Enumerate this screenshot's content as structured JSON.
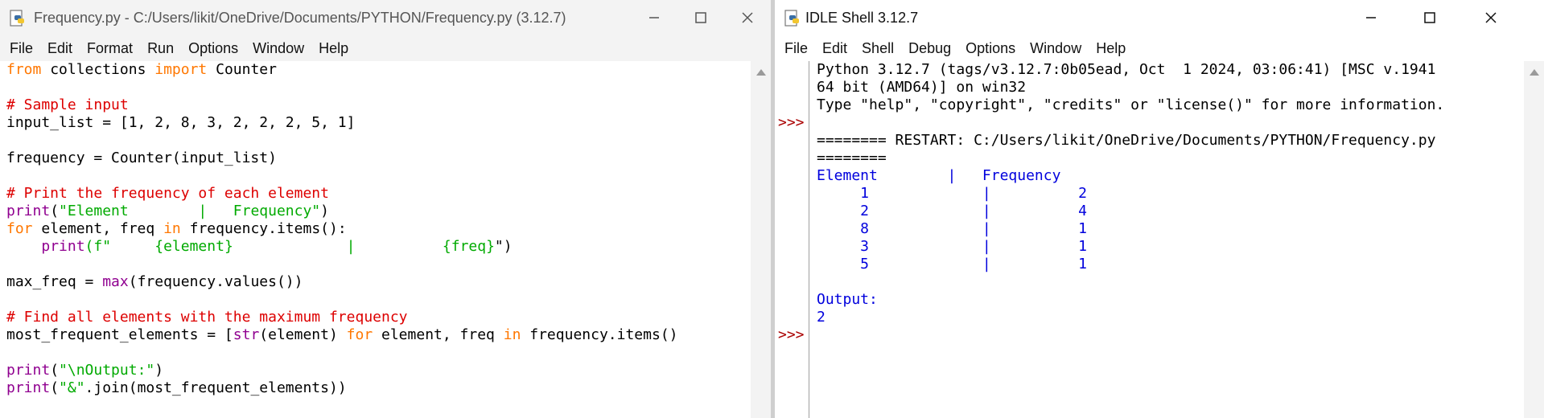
{
  "editor_window": {
    "title": "Frequency.py - C:/Users/likit/OneDrive/Documents/PYTHON/Frequency.py (3.12.7)",
    "menu": [
      "File",
      "Edit",
      "Format",
      "Run",
      "Options",
      "Window",
      "Help"
    ],
    "code": {
      "l1": {
        "a": "from",
        "b": " collections ",
        "c": "import",
        "d": " Counter"
      },
      "l3": "# Sample input",
      "l4": "input_list = [1, 2, 8, 3, 2, 2, 2, 5, 1]",
      "l6": "frequency = Counter(input_list)",
      "l8": "# Print the frequency of each element",
      "l9": {
        "a": "print",
        "b": "(",
        "c": "\"Element        |   Frequency\"",
        "d": ")"
      },
      "l10": {
        "a": "for",
        "b": " element, freq ",
        "c": "in",
        "d": " frequency.items():"
      },
      "l11": {
        "a": "    ",
        "b": "print",
        "c": "(f\"     ",
        "d": "{element}",
        "e": "             |          ",
        "f": "{freq}",
        "g": "\")"
      },
      "l13": {
        "a": "max_freq = ",
        "b": "max",
        "c": "(frequency.values())"
      },
      "l15": "# Find all elements with the maximum frequency",
      "l16": {
        "a": "most_frequent_elements = [",
        "b": "str",
        "c": "(element) ",
        "d": "for",
        "e": " element, freq ",
        "f": "in",
        "g": " frequency.items()"
      },
      "l18": {
        "a": "print",
        "b": "(",
        "c": "\"\\nOutput:\"",
        "d": ")"
      },
      "l19": {
        "a": "print",
        "b": "(",
        "c": "\"&\"",
        "d": ".join(most_frequent_elements))"
      }
    }
  },
  "shell_window": {
    "title": "IDLE Shell 3.12.7",
    "menu": [
      "File",
      "Edit",
      "Shell",
      "Debug",
      "Options",
      "Window",
      "Help"
    ],
    "prompt": ">>>",
    "lines": {
      "l1": "Python 3.12.7 (tags/v3.12.7:0b05ead, Oct  1 2024, 03:06:41) [MSC v.1941",
      "l2": "64 bit (AMD64)] on win32",
      "l3": "Type \"help\", \"copyright\", \"credits\" or \"license()\" for more information.",
      "l4": "======== RESTART: C:/Users/likit/OneDrive/Documents/PYTHON/Frequency.py",
      "l5": "========",
      "o1": "Element        |   Frequency",
      "o2": "     1             |          2",
      "o3": "     2             |          4",
      "o4": "     8             |          1",
      "o5": "     3             |          1",
      "o6": "     5             |          1",
      "o8": "Output:",
      "o9": "2"
    }
  },
  "colors": {
    "keyword": "#ff7700",
    "comment": "#dd0000",
    "string": "#00aa00",
    "builtin": "#900090",
    "output": "#0000dd",
    "prompt": "#aa0000"
  }
}
